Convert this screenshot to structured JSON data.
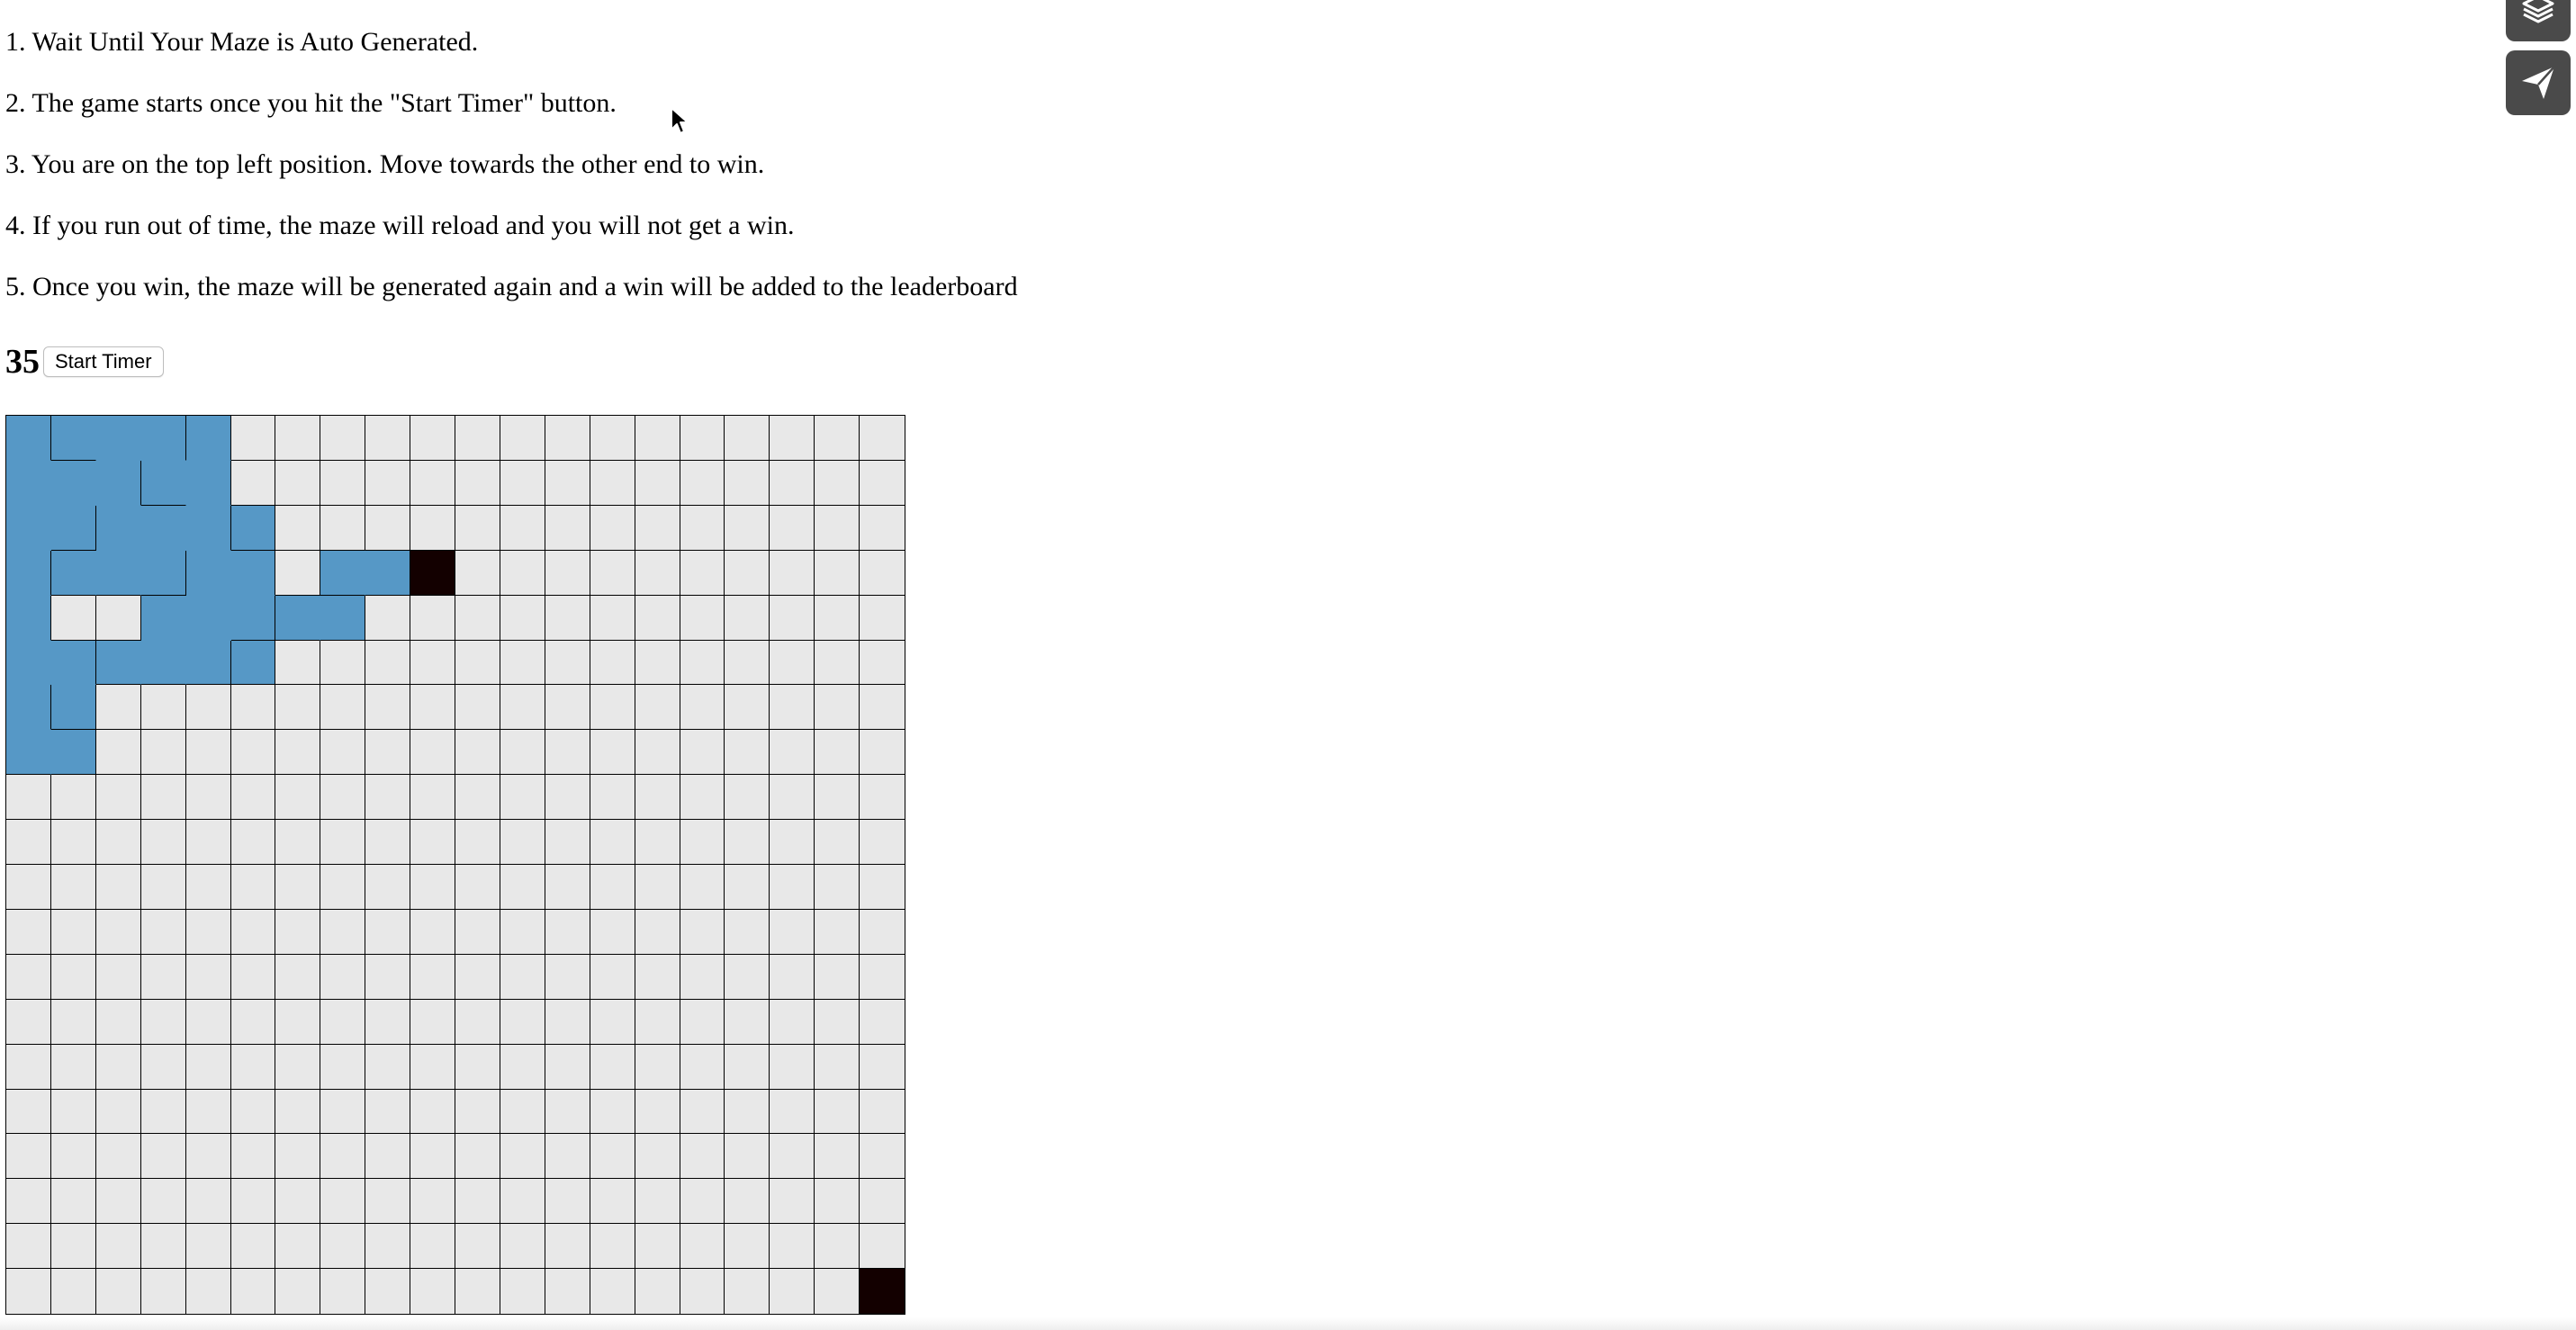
{
  "instructions": [
    "1. Wait Until Your Maze is Auto Generated.",
    "2. The game starts once you hit the \"Start Timer\" button.",
    "3. You are on the top left position. Move towards the other end to win.",
    "4. If you run out of time, the maze will reload and you will not get a win.",
    "5. Once you win, the maze will be generated again and a win will be added to the leaderboard"
  ],
  "timer": {
    "value": "35",
    "button_label": "Start Timer"
  },
  "maze": {
    "rows": 20,
    "cols": 20,
    "visited_cells": [
      [
        0,
        0
      ],
      [
        0,
        1
      ],
      [
        0,
        2
      ],
      [
        0,
        3
      ],
      [
        0,
        4
      ],
      [
        1,
        0
      ],
      [
        1,
        1
      ],
      [
        1,
        2
      ],
      [
        1,
        3
      ],
      [
        1,
        4
      ],
      [
        2,
        0
      ],
      [
        2,
        1
      ],
      [
        2,
        2
      ],
      [
        2,
        3
      ],
      [
        2,
        4
      ],
      [
        2,
        5
      ],
      [
        3,
        0
      ],
      [
        3,
        1
      ],
      [
        3,
        2
      ],
      [
        3,
        3
      ],
      [
        3,
        4
      ],
      [
        3,
        5
      ],
      [
        3,
        7
      ],
      [
        3,
        8
      ],
      [
        4,
        0
      ],
      [
        4,
        3
      ],
      [
        4,
        4
      ],
      [
        4,
        5
      ],
      [
        4,
        6
      ],
      [
        4,
        7
      ],
      [
        5,
        0
      ],
      [
        5,
        1
      ],
      [
        5,
        2
      ],
      [
        5,
        3
      ],
      [
        5,
        4
      ],
      [
        5,
        5
      ],
      [
        6,
        0
      ],
      [
        6,
        1
      ],
      [
        7,
        0
      ],
      [
        7,
        1
      ]
    ],
    "player_position": [
      3,
      9
    ],
    "goal_position": [
      19,
      19
    ],
    "colors": {
      "visited": "#5698c6",
      "empty": "#e8e8e8",
      "player": "#130000",
      "goal": "#130000",
      "wall": "#000000"
    }
  },
  "side_buttons": [
    {
      "icon": "layers-icon"
    },
    {
      "icon": "paper-plane-icon"
    }
  ]
}
